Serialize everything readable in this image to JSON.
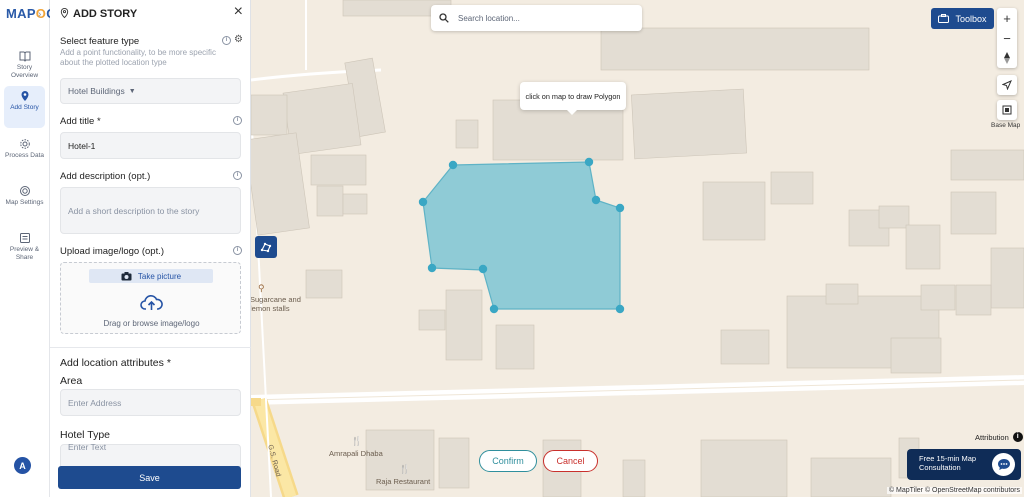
{
  "brand": {
    "logo_text_a": "MAP",
    "logo_text_b": "O",
    "logo_text_c": "G"
  },
  "colors": {
    "primary": "#1e4b8f",
    "accent_polygon": "#8fcbd6",
    "vertex": "#3aa7c4",
    "confirm": "#2f8f9d",
    "cancel": "#c9302c"
  },
  "rail": {
    "items": [
      {
        "label": "Story Overview",
        "icon": "book-icon"
      },
      {
        "label": "Add Story",
        "icon": "location-pin-icon",
        "active": true
      },
      {
        "label": "Process Data",
        "icon": "gear-icon"
      },
      {
        "label": "Map Settings",
        "icon": "settings-icon"
      },
      {
        "label": "Preview & Share",
        "icon": "preview-icon"
      }
    ],
    "avatar": "A"
  },
  "panel": {
    "title": "ADD STORY",
    "feature_type_label": "Select feature type",
    "feature_type_hint": "Add a point functionality, to be more specific about the plotted location type",
    "feature_type_value": "Hotel Buildings",
    "title_label": "Add title *",
    "title_value": "Hotel-1",
    "description_label": "Add description (opt.)",
    "description_placeholder": "Add a short description to the story",
    "upload_label": "Upload image/logo (opt.)",
    "take_picture": "Take picture",
    "drag_browse": "Drag or browse image/logo",
    "location_attrs_label": "Add location attributes *",
    "area_label": "Area",
    "area_placeholder": "Enter Address",
    "hotel_type_label": "Hotel Type",
    "hotel_type_placeholder": "Enter Text",
    "save": "Save"
  },
  "map": {
    "search_placeholder": "Search location...",
    "toolbox": "Toolbox",
    "zoom_in": "+",
    "zoom_out": "−",
    "basemap_label": "Base Map",
    "tooltip": "click on map to draw Polygon",
    "poi": [
      {
        "name": "Sugarcane and lemon stalls"
      },
      {
        "name": "Amrapali Dhaba"
      },
      {
        "name": "Raja Restaurant"
      }
    ],
    "road_label": "G.S. Road",
    "confirm": "Confirm",
    "cancel": "Cancel",
    "attribution": "Attribution",
    "consult_line1": "Free 15-min Map",
    "consult_line2": "Consultation",
    "credit": "© MapTiler © OpenStreetMap contributors"
  }
}
